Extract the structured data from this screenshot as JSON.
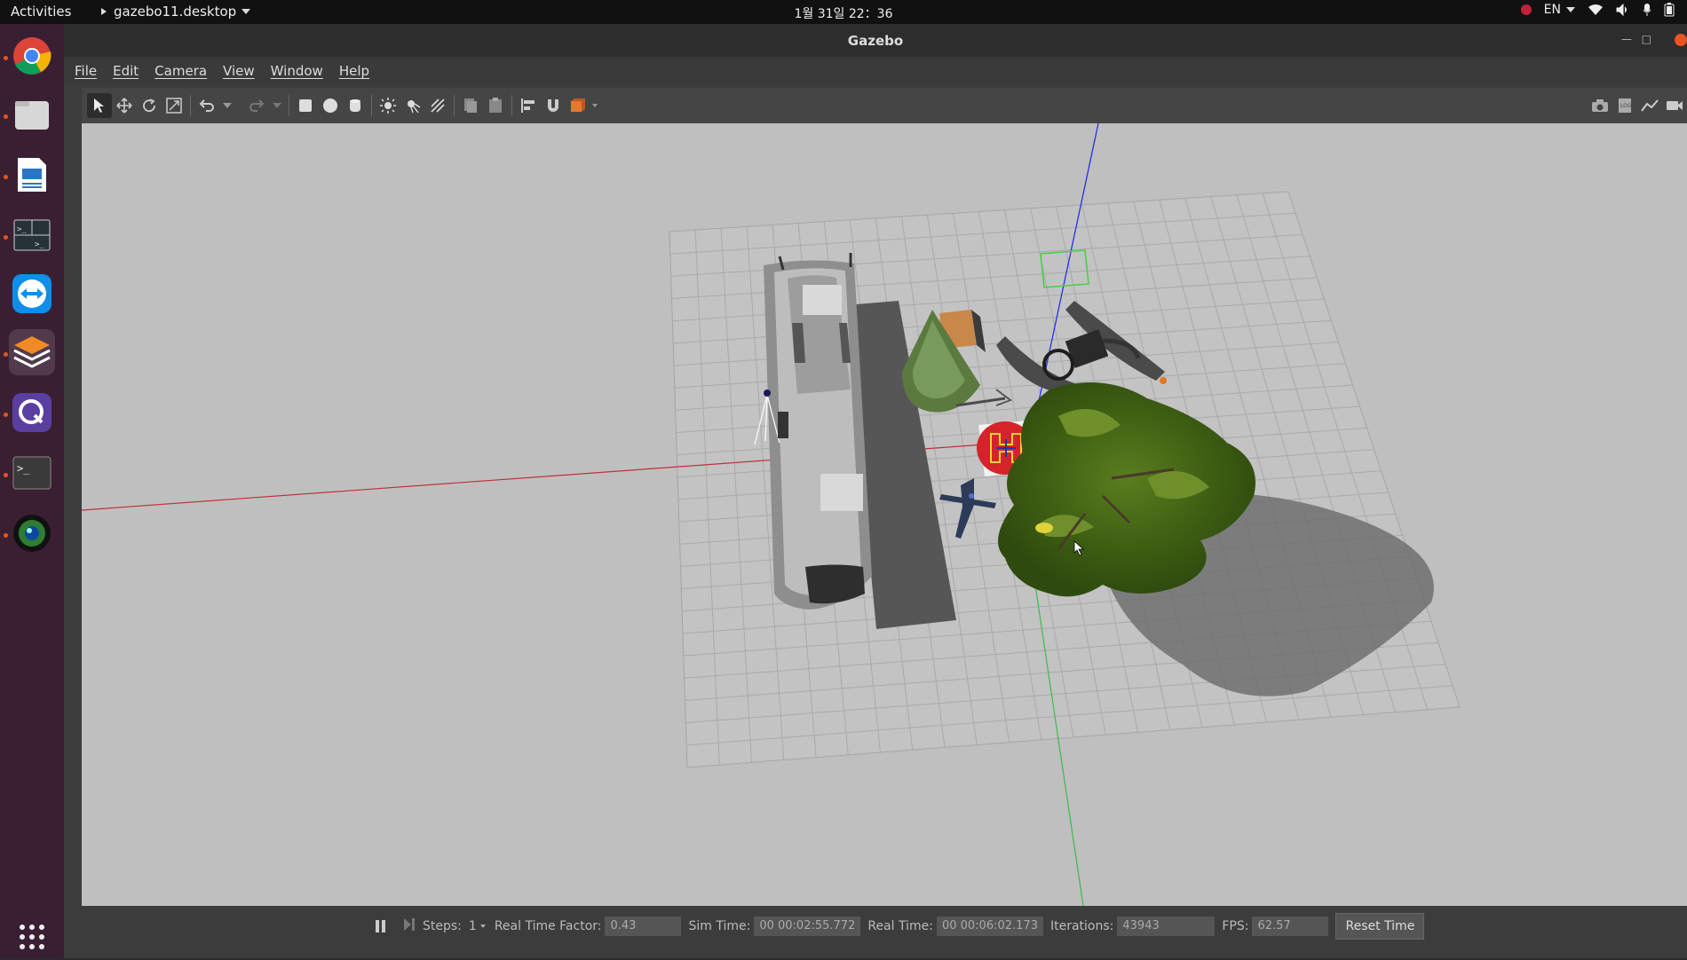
{
  "topbar": {
    "activities": "Activities",
    "app_menu": "gazebo11.desktop",
    "clock": "1월 31일 22：36",
    "language": "EN"
  },
  "dock": {
    "items": [
      {
        "name": "chrome-icon"
      },
      {
        "name": "files-icon"
      },
      {
        "name": "writer-icon"
      },
      {
        "name": "terminal-split-icon"
      },
      {
        "name": "teamviewer-icon"
      },
      {
        "name": "gazebo-icon"
      },
      {
        "name": "qgroundcontrol-icon"
      },
      {
        "name": "terminal-icon"
      },
      {
        "name": "camera-app-icon"
      },
      {
        "name": "show-apps-icon"
      }
    ]
  },
  "window": {
    "title": "Gazebo"
  },
  "menu": {
    "file": "File",
    "edit": "Edit",
    "camera": "Camera",
    "view": "View",
    "window": "Window",
    "help": "Help"
  },
  "status": {
    "steps_label": "Steps:",
    "steps_value": "1",
    "rtf_label": "Real Time Factor:",
    "rtf_value": "0.43",
    "sim_label": "Sim Time:",
    "sim_value": "00 00:02:55.772",
    "real_label": "Real Time:",
    "real_value": "00 00:06:02.173",
    "iter_label": "Iterations:",
    "iter_value": "43943",
    "fps_label": "FPS:",
    "fps_value": "62.57",
    "reset_label": "Reset Time"
  },
  "colors": {
    "dock_bg": "#3a1f33",
    "viewport_bg": "#bfbfbf",
    "accent": "#e95420"
  }
}
